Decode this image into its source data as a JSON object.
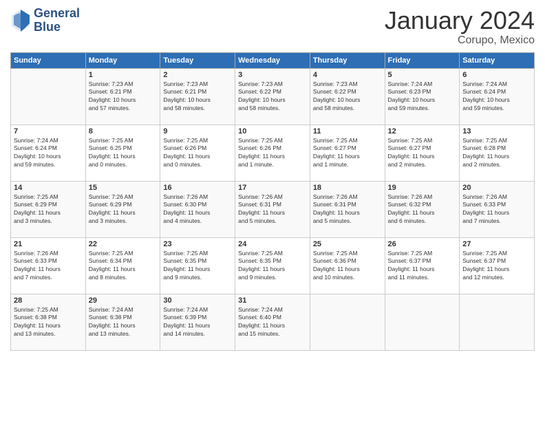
{
  "logo": {
    "line1": "General",
    "line2": "Blue"
  },
  "title": "January 2024",
  "location": "Corupo, Mexico",
  "days_header": [
    "Sunday",
    "Monday",
    "Tuesday",
    "Wednesday",
    "Thursday",
    "Friday",
    "Saturday"
  ],
  "weeks": [
    [
      {
        "num": "",
        "info": ""
      },
      {
        "num": "1",
        "info": "Sunrise: 7:23 AM\nSunset: 6:21 PM\nDaylight: 10 hours\nand 57 minutes."
      },
      {
        "num": "2",
        "info": "Sunrise: 7:23 AM\nSunset: 6:21 PM\nDaylight: 10 hours\nand 58 minutes."
      },
      {
        "num": "3",
        "info": "Sunrise: 7:23 AM\nSunset: 6:22 PM\nDaylight: 10 hours\nand 58 minutes."
      },
      {
        "num": "4",
        "info": "Sunrise: 7:23 AM\nSunset: 6:22 PM\nDaylight: 10 hours\nand 58 minutes."
      },
      {
        "num": "5",
        "info": "Sunrise: 7:24 AM\nSunset: 6:23 PM\nDaylight: 10 hours\nand 59 minutes."
      },
      {
        "num": "6",
        "info": "Sunrise: 7:24 AM\nSunset: 6:24 PM\nDaylight: 10 hours\nand 59 minutes."
      }
    ],
    [
      {
        "num": "7",
        "info": "Sunrise: 7:24 AM\nSunset: 6:24 PM\nDaylight: 10 hours\nand 59 minutes."
      },
      {
        "num": "8",
        "info": "Sunrise: 7:25 AM\nSunset: 6:25 PM\nDaylight: 11 hours\nand 0 minutes."
      },
      {
        "num": "9",
        "info": "Sunrise: 7:25 AM\nSunset: 6:26 PM\nDaylight: 11 hours\nand 0 minutes."
      },
      {
        "num": "10",
        "info": "Sunrise: 7:25 AM\nSunset: 6:26 PM\nDaylight: 11 hours\nand 1 minute."
      },
      {
        "num": "11",
        "info": "Sunrise: 7:25 AM\nSunset: 6:27 PM\nDaylight: 11 hours\nand 1 minute."
      },
      {
        "num": "12",
        "info": "Sunrise: 7:25 AM\nSunset: 6:27 PM\nDaylight: 11 hours\nand 2 minutes."
      },
      {
        "num": "13",
        "info": "Sunrise: 7:25 AM\nSunset: 6:28 PM\nDaylight: 11 hours\nand 2 minutes."
      }
    ],
    [
      {
        "num": "14",
        "info": "Sunrise: 7:25 AM\nSunset: 6:29 PM\nDaylight: 11 hours\nand 3 minutes."
      },
      {
        "num": "15",
        "info": "Sunrise: 7:26 AM\nSunset: 6:29 PM\nDaylight: 11 hours\nand 3 minutes."
      },
      {
        "num": "16",
        "info": "Sunrise: 7:26 AM\nSunset: 6:30 PM\nDaylight: 11 hours\nand 4 minutes."
      },
      {
        "num": "17",
        "info": "Sunrise: 7:26 AM\nSunset: 6:31 PM\nDaylight: 11 hours\nand 5 minutes."
      },
      {
        "num": "18",
        "info": "Sunrise: 7:26 AM\nSunset: 6:31 PM\nDaylight: 11 hours\nand 5 minutes."
      },
      {
        "num": "19",
        "info": "Sunrise: 7:26 AM\nSunset: 6:32 PM\nDaylight: 11 hours\nand 6 minutes."
      },
      {
        "num": "20",
        "info": "Sunrise: 7:26 AM\nSunset: 6:33 PM\nDaylight: 11 hours\nand 7 minutes."
      }
    ],
    [
      {
        "num": "21",
        "info": "Sunrise: 7:26 AM\nSunset: 6:33 PM\nDaylight: 11 hours\nand 7 minutes."
      },
      {
        "num": "22",
        "info": "Sunrise: 7:25 AM\nSunset: 6:34 PM\nDaylight: 11 hours\nand 8 minutes."
      },
      {
        "num": "23",
        "info": "Sunrise: 7:25 AM\nSunset: 6:35 PM\nDaylight: 11 hours\nand 9 minutes."
      },
      {
        "num": "24",
        "info": "Sunrise: 7:25 AM\nSunset: 6:35 PM\nDaylight: 11 hours\nand 9 minutes."
      },
      {
        "num": "25",
        "info": "Sunrise: 7:25 AM\nSunset: 6:36 PM\nDaylight: 11 hours\nand 10 minutes."
      },
      {
        "num": "26",
        "info": "Sunrise: 7:25 AM\nSunset: 6:37 PM\nDaylight: 11 hours\nand 11 minutes."
      },
      {
        "num": "27",
        "info": "Sunrise: 7:25 AM\nSunset: 6:37 PM\nDaylight: 11 hours\nand 12 minutes."
      }
    ],
    [
      {
        "num": "28",
        "info": "Sunrise: 7:25 AM\nSunset: 6:38 PM\nDaylight: 11 hours\nand 13 minutes."
      },
      {
        "num": "29",
        "info": "Sunrise: 7:24 AM\nSunset: 6:38 PM\nDaylight: 11 hours\nand 13 minutes."
      },
      {
        "num": "30",
        "info": "Sunrise: 7:24 AM\nSunset: 6:39 PM\nDaylight: 11 hours\nand 14 minutes."
      },
      {
        "num": "31",
        "info": "Sunrise: 7:24 AM\nSunset: 6:40 PM\nDaylight: 11 hours\nand 15 minutes."
      },
      {
        "num": "",
        "info": ""
      },
      {
        "num": "",
        "info": ""
      },
      {
        "num": "",
        "info": ""
      }
    ]
  ]
}
